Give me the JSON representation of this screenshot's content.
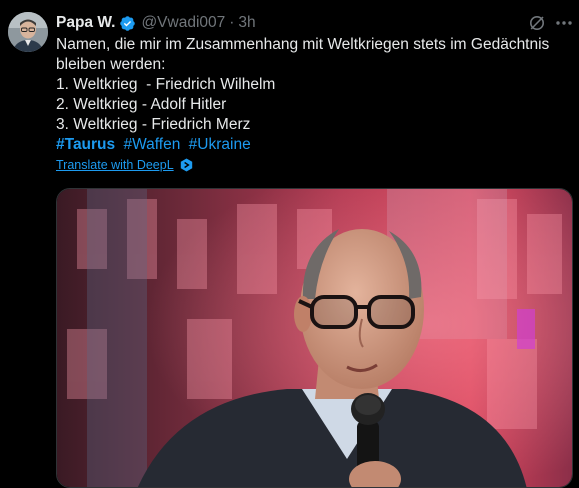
{
  "tweet": {
    "display_name": "Papa W.",
    "handle": "@Vwadi007",
    "separator": "·",
    "time": "3h",
    "lines": [
      "Namen, die mir im Zusammenhang mit Weltkriegen stets im Gedächtnis",
      "bleiben werden:",
      "1. Weltkrieg  - Friedrich Wilhelm",
      "2. Weltkrieg - Adolf Hitler",
      "3. Weltkrieg - Friedrich Merz"
    ],
    "hashtags": [
      "#Taurus",
      "#Waffen",
      "#Ukraine"
    ],
    "translate_label": "Translate with DeepL"
  },
  "icons": {
    "verified": "verified-badge-icon",
    "grok": "grok-icon",
    "more": "more-icon",
    "deepl": "deepl-icon"
  },
  "colors": {
    "background": "#000000",
    "text": "#e7e9ea",
    "secondary": "#71767b",
    "accent": "#1d9bf0"
  }
}
